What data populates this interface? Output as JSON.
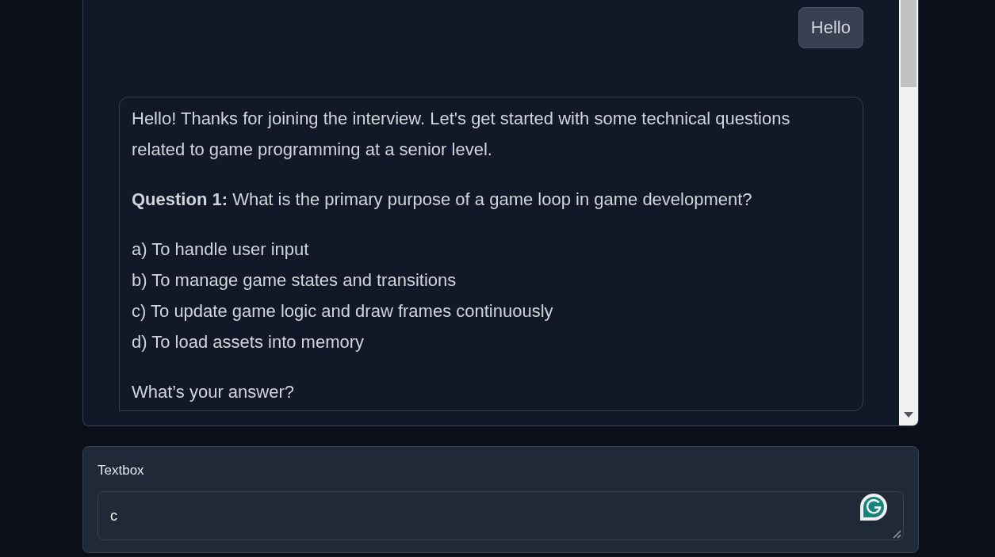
{
  "chat": {
    "messages": [
      {
        "kind": "user",
        "text": "Hello"
      },
      {
        "kind": "bot",
        "blocks": [
          {
            "kind": "paragraph",
            "text": "Hello! Thanks for joining the interview. Let's get started with some technical questions related to game programming at a senior level."
          },
          {
            "kind": "paragraph",
            "text": "**Question 1:** What is the primary purpose of a game loop in game development?"
          },
          {
            "kind": "lines",
            "lines": [
              "a) To handle user input",
              "b) To manage game states and transitions",
              "c) To update game logic and draw frames continuously",
              "d) To load assets into memory"
            ]
          },
          {
            "kind": "paragraph",
            "text": "What’s your answer?"
          }
        ]
      }
    ]
  },
  "textbox": {
    "label": "Textbox",
    "value": "c"
  }
}
